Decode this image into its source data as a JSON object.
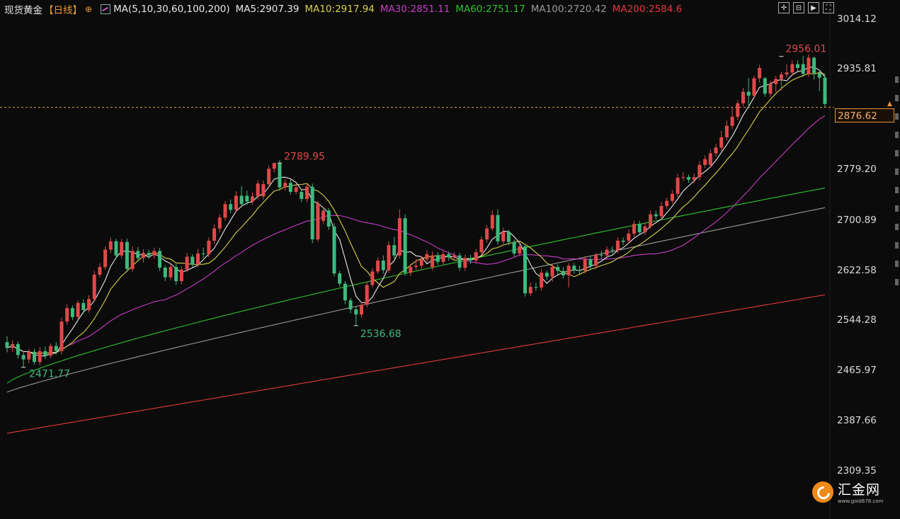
{
  "header": {
    "title": "现货黄金",
    "period": "【日线】",
    "add_symbol": "⊕",
    "ma_params": "MA(5,10,30,60,100,200)",
    "ma_values": [
      {
        "label": "MA5:2907.39",
        "color": "#e8e8e8"
      },
      {
        "label": "MA10:2917.94",
        "color": "#d8d24a"
      },
      {
        "label": "MA30:2851.11",
        "color": "#c63cc6"
      },
      {
        "label": "MA60:2751.17",
        "color": "#2ec22e"
      },
      {
        "label": "MA100:2720.42",
        "color": "#9a9a9a"
      },
      {
        "label": "MA200:2584.6",
        "color": "#e23a3a"
      }
    ]
  },
  "toolbar": [
    "crosshair-icon",
    "zoom-out-icon",
    "play-icon",
    "fullscreen-icon"
  ],
  "yaxis": {
    "labels": [
      "3014.12",
      "2935.81",
      "2779.20",
      "2700.89",
      "2622.58",
      "2544.28",
      "2465.97",
      "2387.66",
      "2309.35"
    ],
    "current_price": "2876.62"
  },
  "annotations": {
    "low_1": "2471.77",
    "high_1": "2789.95",
    "low_2": "2536.68",
    "high_2": "2956.01"
  },
  "logo": {
    "name": "汇金网",
    "url": "www.gold678.com"
  },
  "colors": {
    "up": "#e04848",
    "down": "#3dba7d",
    "accent": "#e8963c"
  },
  "chart_data": {
    "type": "candlestick",
    "ylim": [
      2309.35,
      3014.12
    ],
    "candles": [
      [
        2511,
        2502,
        2520,
        2495
      ],
      [
        2502,
        2508,
        2514,
        2496
      ],
      [
        2508,
        2491,
        2512,
        2485
      ],
      [
        2491,
        2484,
        2497,
        2472
      ],
      [
        2484,
        2496,
        2500,
        2478
      ],
      [
        2496,
        2480,
        2501,
        2476
      ],
      [
        2480,
        2497,
        2503,
        2475
      ],
      [
        2497,
        2490,
        2504,
        2485
      ],
      [
        2490,
        2505,
        2509,
        2486
      ],
      [
        2505,
        2497,
        2511,
        2492
      ],
      [
        2497,
        2543,
        2549,
        2492
      ],
      [
        2543,
        2564,
        2570,
        2538
      ],
      [
        2564,
        2550,
        2568,
        2545
      ],
      [
        2550,
        2572,
        2576,
        2546
      ],
      [
        2572,
        2561,
        2578,
        2555
      ],
      [
        2561,
        2578,
        2584,
        2557
      ],
      [
        2578,
        2616,
        2622,
        2575
      ],
      [
        2616,
        2628,
        2634,
        2612
      ],
      [
        2628,
        2655,
        2660,
        2624
      ],
      [
        2655,
        2668,
        2674,
        2650
      ],
      [
        2668,
        2646,
        2672,
        2641
      ],
      [
        2646,
        2667,
        2672,
        2641
      ],
      [
        2667,
        2625,
        2672,
        2620
      ],
      [
        2625,
        2653,
        2660,
        2620
      ],
      [
        2653,
        2642,
        2659,
        2637
      ],
      [
        2642,
        2650,
        2656,
        2635
      ],
      [
        2650,
        2646,
        2655,
        2641
      ],
      [
        2646,
        2653,
        2658,
        2641
      ],
      [
        2653,
        2627,
        2658,
        2622
      ],
      [
        2627,
        2612,
        2631,
        2606
      ],
      [
        2612,
        2628,
        2633,
        2607
      ],
      [
        2628,
        2606,
        2633,
        2600
      ],
      [
        2606,
        2624,
        2629,
        2601
      ],
      [
        2624,
        2644,
        2650,
        2620
      ],
      [
        2644,
        2632,
        2648,
        2627
      ],
      [
        2632,
        2649,
        2656,
        2628
      ],
      [
        2649,
        2648,
        2658,
        2642
      ],
      [
        2648,
        2669,
        2674,
        2643
      ],
      [
        2669,
        2688,
        2694,
        2664
      ],
      [
        2688,
        2705,
        2710,
        2682
      ],
      [
        2705,
        2726,
        2731,
        2700
      ],
      [
        2726,
        2717,
        2733,
        2712
      ],
      [
        2717,
        2739,
        2746,
        2713
      ],
      [
        2739,
        2726,
        2754,
        2722
      ],
      [
        2739,
        2730,
        2747,
        2725
      ],
      [
        2730,
        2738,
        2744,
        2725
      ],
      [
        2738,
        2758,
        2763,
        2733
      ],
      [
        2738,
        2757,
        2763,
        2733
      ],
      [
        2757,
        2781,
        2786,
        2752
      ],
      [
        2781,
        2790,
        2790,
        2775
      ],
      [
        2790,
        2752,
        2795,
        2747
      ],
      [
        2752,
        2759,
        2765,
        2747
      ],
      [
        2759,
        2745,
        2764,
        2741
      ],
      [
        2745,
        2752,
        2757,
        2741
      ],
      [
        2745,
        2734,
        2750,
        2729
      ],
      [
        2734,
        2753,
        2758,
        2729
      ],
      [
        2753,
        2671,
        2758,
        2665
      ],
      [
        2671,
        2727,
        2731,
        2667
      ],
      [
        2700,
        2716,
        2722,
        2695
      ],
      [
        2716,
        2691,
        2720,
        2686
      ],
      [
        2691,
        2618,
        2696,
        2613
      ],
      [
        2618,
        2602,
        2622,
        2597
      ],
      [
        2602,
        2576,
        2606,
        2570
      ],
      [
        2576,
        2562,
        2580,
        2556
      ],
      [
        2562,
        2554,
        2566,
        2537
      ],
      [
        2554,
        2569,
        2574,
        2549
      ],
      [
        2569,
        2600,
        2605,
        2565
      ],
      [
        2600,
        2621,
        2626,
        2596
      ],
      [
        2621,
        2638,
        2643,
        2617
      ],
      [
        2638,
        2623,
        2646,
        2618
      ],
      [
        2623,
        2662,
        2668,
        2619
      ],
      [
        2662,
        2646,
        2675,
        2641
      ],
      [
        2646,
        2704,
        2718,
        2641
      ],
      [
        2704,
        2619,
        2710,
        2614
      ],
      [
        2619,
        2628,
        2633,
        2614
      ],
      [
        2628,
        2630,
        2640,
        2623
      ],
      [
        2630,
        2640,
        2645,
        2625
      ],
      [
        2640,
        2648,
        2654,
        2635
      ],
      [
        2628,
        2646,
        2652,
        2623
      ],
      [
        2646,
        2636,
        2651,
        2631
      ],
      [
        2636,
        2648,
        2653,
        2631
      ],
      [
        2648,
        2643,
        2652,
        2638
      ],
      [
        2643,
        2646,
        2651,
        2638
      ],
      [
        2646,
        2627,
        2650,
        2622
      ],
      [
        2627,
        2642,
        2647,
        2622
      ],
      [
        2642,
        2638,
        2647,
        2633
      ],
      [
        2638,
        2651,
        2656,
        2633
      ],
      [
        2651,
        2671,
        2676,
        2646
      ],
      [
        2671,
        2688,
        2693,
        2666
      ],
      [
        2688,
        2709,
        2716,
        2684
      ],
      [
        2709,
        2668,
        2718,
        2663
      ],
      [
        2668,
        2683,
        2689,
        2664
      ],
      [
        2683,
        2667,
        2686,
        2662
      ],
      [
        2667,
        2649,
        2671,
        2644
      ],
      [
        2649,
        2660,
        2665,
        2645
      ],
      [
        2660,
        2587,
        2664,
        2582
      ],
      [
        2587,
        2597,
        2604,
        2583
      ],
      [
        2597,
        2596,
        2603,
        2591
      ],
      [
        2596,
        2619,
        2625,
        2591
      ],
      [
        2619,
        2613,
        2623,
        2608
      ],
      [
        2613,
        2628,
        2632,
        2605
      ],
      [
        2628,
        2622,
        2632,
        2616
      ],
      [
        2622,
        2615,
        2628,
        2610
      ],
      [
        2615,
        2630,
        2634,
        2596
      ],
      [
        2630,
        2623,
        2634,
        2618
      ],
      [
        2623,
        2622,
        2630,
        2617
      ],
      [
        2622,
        2640,
        2645,
        2618
      ],
      [
        2640,
        2630,
        2645,
        2625
      ],
      [
        2630,
        2647,
        2650,
        2625
      ],
      [
        2647,
        2646,
        2653,
        2641
      ],
      [
        2646,
        2655,
        2660,
        2641
      ],
      [
        2655,
        2654,
        2660,
        2649
      ],
      [
        2654,
        2669,
        2674,
        2649
      ],
      [
        2669,
        2667,
        2674,
        2662
      ],
      [
        2669,
        2680,
        2686,
        2664
      ],
      [
        2680,
        2695,
        2700,
        2675
      ],
      [
        2695,
        2682,
        2700,
        2677
      ],
      [
        2682,
        2691,
        2697,
        2678
      ],
      [
        2691,
        2710,
        2716,
        2687
      ],
      [
        2710,
        2707,
        2716,
        2702
      ],
      [
        2707,
        2723,
        2729,
        2702
      ],
      [
        2723,
        2731,
        2736,
        2718
      ],
      [
        2731,
        2742,
        2748,
        2727
      ],
      [
        2742,
        2767,
        2773,
        2737
      ],
      [
        2767,
        2768,
        2776,
        2762
      ],
      [
        2768,
        2764,
        2772,
        2759
      ],
      [
        2764,
        2768,
        2774,
        2759
      ],
      [
        2768,
        2787,
        2793,
        2763
      ],
      [
        2787,
        2796,
        2802,
        2782
      ],
      [
        2787,
        2805,
        2811,
        2783
      ],
      [
        2805,
        2814,
        2820,
        2800
      ],
      [
        2814,
        2830,
        2840,
        2809
      ],
      [
        2830,
        2848,
        2856,
        2825
      ],
      [
        2848,
        2862,
        2876,
        2843
      ],
      [
        2862,
        2883,
        2888,
        2857
      ],
      [
        2883,
        2901,
        2907,
        2878
      ],
      [
        2901,
        2895,
        2922,
        2876
      ],
      [
        2895,
        2922,
        2926,
        2890
      ],
      [
        2922,
        2938,
        2943,
        2915
      ],
      [
        2922,
        2898,
        2924,
        2893
      ],
      [
        2898,
        2913,
        2918,
        2893
      ],
      [
        2913,
        2921,
        2926,
        2900
      ],
      [
        2921,
        2928,
        2932,
        2903
      ],
      [
        2928,
        2931,
        2944,
        2923
      ],
      [
        2931,
        2944,
        2950,
        2926
      ],
      [
        2944,
        2938,
        2950,
        2933
      ],
      [
        2944,
        2929,
        2957,
        2924
      ],
      [
        2929,
        2954,
        2959,
        2924
      ],
      [
        2954,
        2930,
        2956,
        2920
      ],
      [
        2930,
        2923,
        2935,
        2902
      ],
      [
        2923,
        2882,
        2928,
        2877
      ]
    ],
    "moving_averages": [
      {
        "name": "MA5",
        "value": 2907.39,
        "color": "#e8e8e8"
      },
      {
        "name": "MA10",
        "value": 2917.94,
        "color": "#d8d24a"
      },
      {
        "name": "MA30",
        "value": 2851.11,
        "color": "#c63cc6"
      },
      {
        "name": "MA60",
        "value": 2751.17,
        "color": "#2ec22e"
      },
      {
        "name": "MA100",
        "value": 2720.42,
        "color": "#9a9a9a"
      },
      {
        "name": "MA200",
        "value": 2584.6,
        "color": "#e23a3a"
      }
    ],
    "last_price": 2876.62,
    "marked_high": 2956.01,
    "marked_low": 2471.77
  }
}
